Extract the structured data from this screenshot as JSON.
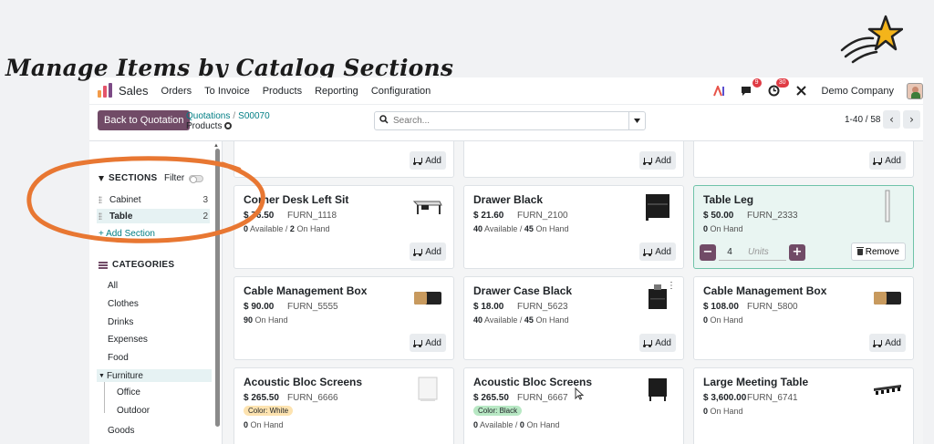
{
  "caption": "Manage Items by Catalog Sections",
  "nav": {
    "app_name": "Sales",
    "items": [
      "Orders",
      "To Invoice",
      "Products",
      "Reporting",
      "Configuration"
    ],
    "chat_badge": "9",
    "activity_badge": "30",
    "company": "Demo Company"
  },
  "control": {
    "back_label": "Back to Quotation",
    "crumb_quotations": "Quotations",
    "crumb_order": "S00070",
    "crumb_current": "Products",
    "search_placeholder": "Search...",
    "pager": "1-40 / 58"
  },
  "sidebar": {
    "sections_title": "SECTIONS",
    "filter_label": "Filter",
    "sections": [
      {
        "label": "Cabinet",
        "count": "3"
      },
      {
        "label": "Table",
        "count": "2"
      }
    ],
    "add_section": "+ Add Section",
    "categories_title": "CATEGORIES",
    "categories": [
      "All",
      "Clothes",
      "Drinks",
      "Expenses",
      "Food"
    ],
    "furniture": "Furniture",
    "furniture_children": [
      "Office",
      "Outdoor"
    ],
    "goods": "Goods"
  },
  "buttons": {
    "add": "Add",
    "remove": "Remove"
  },
  "selected_qty": {
    "value": "4",
    "unit": "Units"
  },
  "products": [
    {
      "name": "Corner Desk Left Sit",
      "price": "$ 76.50",
      "ref": "FURN_1118",
      "available": "0",
      "available_label": "Available",
      "on_hand": "2",
      "on_hand_label": "On Hand"
    },
    {
      "name": "Drawer Black",
      "price": "$ 21.60",
      "ref": "FURN_2100",
      "available": "40",
      "available_label": "Available",
      "on_hand": "45",
      "on_hand_label": "On Hand"
    },
    {
      "name": "Table Leg",
      "price": "$ 50.00",
      "ref": "FURN_2333",
      "on_hand": "0",
      "on_hand_label": "On Hand"
    },
    {
      "name": "Cable Management Box",
      "price": "$ 90.00",
      "ref": "FURN_5555",
      "on_hand": "90",
      "on_hand_label": "On Hand"
    },
    {
      "name": "Drawer Case Black",
      "price": "$ 18.00",
      "ref": "FURN_5623",
      "available": "40",
      "available_label": "Available",
      "on_hand": "45",
      "on_hand_label": "On Hand"
    },
    {
      "name": "Cable Management Box",
      "price": "$ 108.00",
      "ref": "FURN_5800",
      "on_hand": "0",
      "on_hand_label": "On Hand"
    },
    {
      "name": "Acoustic Bloc Screens",
      "price": "$ 265.50",
      "ref": "FURN_6666",
      "tag": "Color: White",
      "on_hand": "0",
      "on_hand_label": "On Hand"
    },
    {
      "name": "Acoustic Bloc Screens",
      "price": "$ 265.50",
      "ref": "FURN_6667",
      "tag": "Color: Black",
      "available": "0",
      "available_label": "Available",
      "on_hand": "0",
      "on_hand_label": "On Hand"
    },
    {
      "name": "Large Meeting Table",
      "price": "$ 3,600.00",
      "ref": "FURN_6741",
      "on_hand": "0",
      "on_hand_label": "On Hand"
    }
  ],
  "colors": {
    "brand": "#714b67",
    "link": "#017e84",
    "highlight": "#e87732",
    "selected_bg": "#e9f5f2",
    "tag_white": "#fde3b0",
    "tag_black": "#b8e8c4"
  }
}
